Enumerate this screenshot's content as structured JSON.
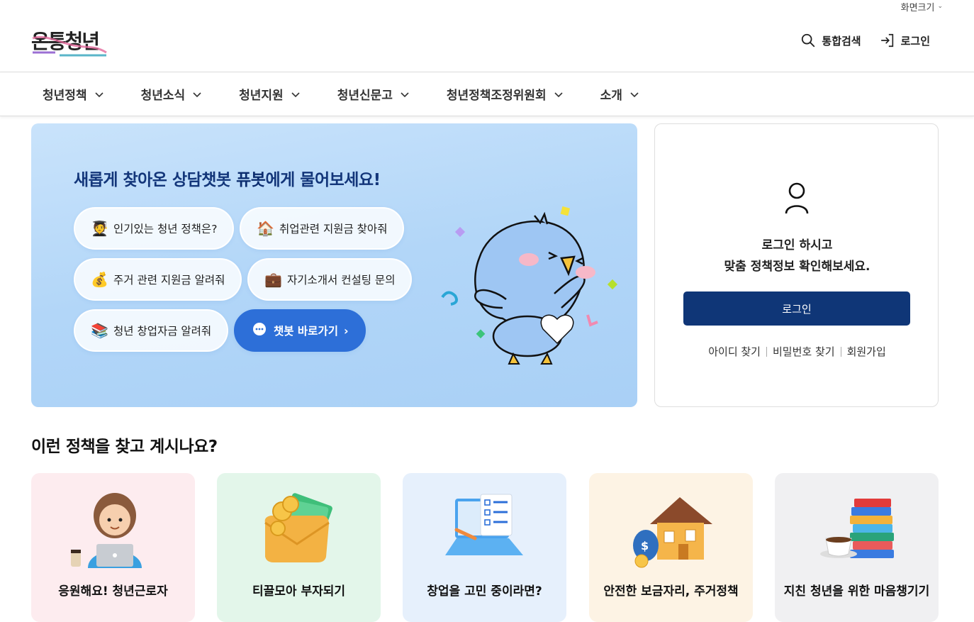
{
  "util": {
    "screen_size": "화면크기"
  },
  "header": {
    "logo_text": "온통청년",
    "search_label": "통합검색",
    "login_label": "로그인"
  },
  "nav": [
    {
      "label": "청년정책"
    },
    {
      "label": "청년소식"
    },
    {
      "label": "청년지원"
    },
    {
      "label": "청년신문고"
    },
    {
      "label": "청년정책조정위원회"
    },
    {
      "label": "소개"
    }
  ],
  "hero": {
    "title_pre": "새롭게 찾아온 상담챗봇 ",
    "title_hl": "퓨봇",
    "title_post": "에게 물어보세요!",
    "chips": [
      {
        "icon": "student-icon",
        "label": "인기있는 청년 정책은?"
      },
      {
        "icon": "house-icon",
        "label": "취업관련 지원금 찾아줘"
      },
      {
        "icon": "money-bag-icon",
        "label": "주거 관련 지원금 알려줘"
      },
      {
        "icon": "briefcase-icon",
        "label": "자기소개서 컨설팅 문의"
      },
      {
        "icon": "books-icon",
        "label": "청년 창업자금 알려줘"
      }
    ],
    "chatbot_button": "챗봇 바로가기"
  },
  "login_card": {
    "line1": "로그인 하시고",
    "line2": "맞춤 정책정보 확인해보세요.",
    "button": "로그인",
    "links": [
      "아이디 찾기",
      "비밀번호 찾기",
      "회원가입"
    ]
  },
  "section": {
    "title": "이런 정책을 찾고 계시나요?",
    "cards": [
      {
        "label": "응원해요! 청년근로자",
        "bg": "#fdecef",
        "icon": "worker-icon"
      },
      {
        "label": "티끌모아 부자되기",
        "bg": "#e3f6ea",
        "icon": "wallet-icon"
      },
      {
        "label": "창업을 고민 중이라면?",
        "bg": "#e6f0fc",
        "icon": "laptop-icon"
      },
      {
        "label": "안전한 보금자리, 주거정책",
        "bg": "#fdf3e4",
        "icon": "house-icon"
      },
      {
        "label": "지친 청년을 위한 마음챙기기",
        "bg": "#f0f0f2",
        "icon": "books-icon"
      }
    ]
  },
  "colors": {
    "primary": "#0f3677",
    "accent": "#2d6fd8"
  }
}
